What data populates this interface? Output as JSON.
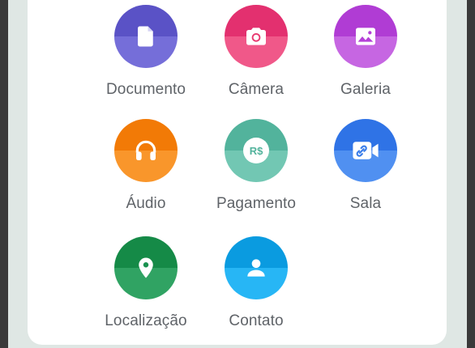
{
  "attach_menu": {
    "items": [
      {
        "label": "Documento",
        "icon": "document-icon",
        "color_top": "#5a52c6",
        "color_bottom": "#6a62d6"
      },
      {
        "label": "Câmera",
        "icon": "camera-icon",
        "color_top": "#e3306f",
        "color_bottom": "#ef4a7f"
      },
      {
        "label": "Galeria",
        "icon": "gallery-icon",
        "color_top": "#b03cd4",
        "color_bottom": "#c25ae0"
      },
      {
        "label": "Áudio",
        "icon": "headphones-icon",
        "color_top": "#f27a06",
        "color_bottom": "#f98e1a"
      },
      {
        "label": "Pagamento",
        "icon": "payment-icon",
        "color_top": "#52b39c",
        "color_bottom": "#67c3ad",
        "icon_text": "R$"
      },
      {
        "label": "Sala",
        "icon": "video-room-icon",
        "color_top": "#2f73e6",
        "color_bottom": "#4287f0"
      },
      {
        "label": "Localização",
        "icon": "location-pin-icon",
        "color_top": "#158a47",
        "color_bottom": "#1f9c56"
      },
      {
        "label": "Contato",
        "icon": "contact-icon",
        "color_top": "#0a9be0",
        "color_bottom": "#15b0f5"
      }
    ]
  }
}
